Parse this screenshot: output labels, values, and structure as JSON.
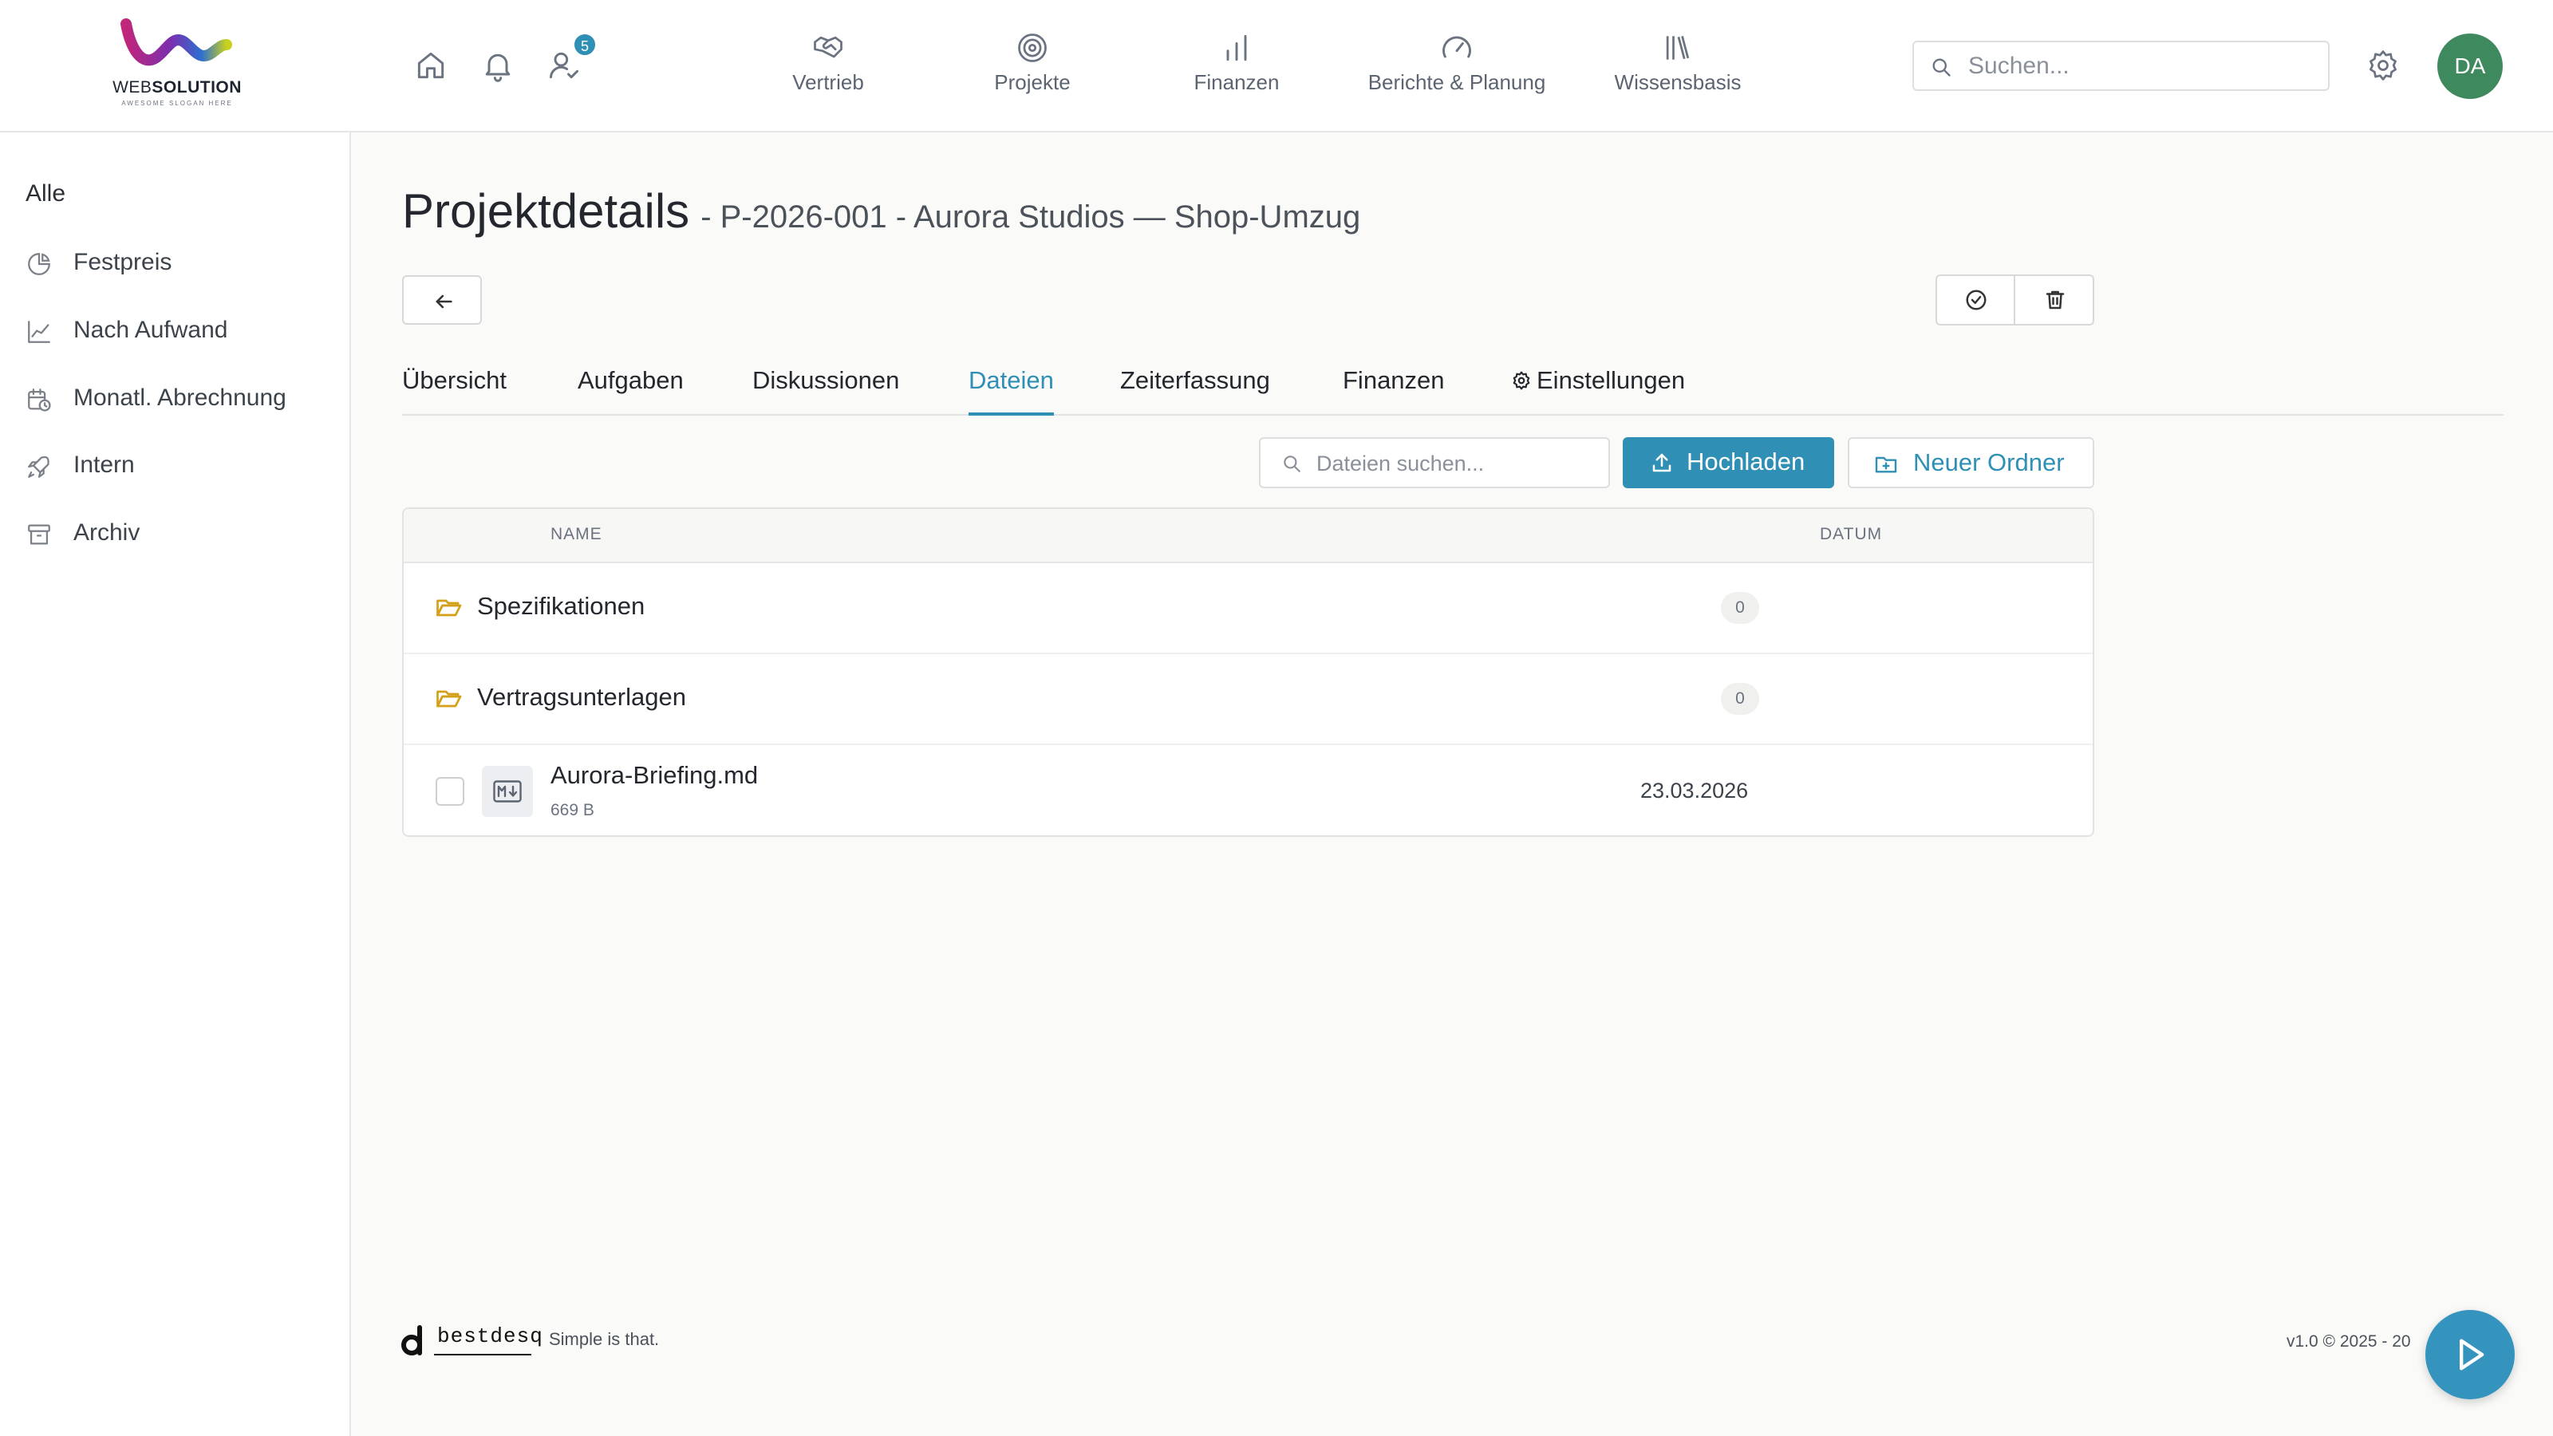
{
  "brand": {
    "name_bold": "WEB",
    "name_rest": "SOLUTION",
    "tagline": "AWESOME SLOGAN HERE"
  },
  "header": {
    "notification_count": "5",
    "nav": [
      {
        "label": "Vertrieb",
        "icon": "handshake-icon"
      },
      {
        "label": "Projekte",
        "icon": "target-icon"
      },
      {
        "label": "Finanzen",
        "icon": "bar-chart-icon"
      },
      {
        "label": "Berichte & Planung",
        "icon": "gauge-icon"
      },
      {
        "label": "Wissensbasis",
        "icon": "library-icon"
      }
    ],
    "search_placeholder": "Suchen...",
    "avatar_initials": "DA",
    "accent_color": "#2f8fb5",
    "avatar_color": "#3e8a5e"
  },
  "sidebar": {
    "all_label": "Alle",
    "items": [
      {
        "label": "Festpreis",
        "icon": "pie-chart-icon"
      },
      {
        "label": "Nach Aufwand",
        "icon": "line-chart-icon"
      },
      {
        "label": "Monatl. Abrechnung",
        "icon": "calendar-clock-icon"
      },
      {
        "label": "Intern",
        "icon": "rocket-icon"
      },
      {
        "label": "Archiv",
        "icon": "archive-icon"
      }
    ]
  },
  "page": {
    "title": "Projektdetails",
    "subtitle": "- P-2026-001 - Aurora Studios — Shop-Umzug"
  },
  "tabs": [
    {
      "label": "Übersicht",
      "active": false
    },
    {
      "label": "Aufgaben",
      "active": false
    },
    {
      "label": "Diskussionen",
      "active": false
    },
    {
      "label": "Dateien",
      "active": true
    },
    {
      "label": "Zeiterfassung",
      "active": false
    },
    {
      "label": "Finanzen",
      "active": false
    },
    {
      "label": "Einstellungen",
      "active": false
    }
  ],
  "files": {
    "search_placeholder": "Dateien suchen...",
    "upload_label": "Hochladen",
    "new_folder_label": "Neuer Ordner",
    "columns": {
      "name": "NAME",
      "date": "DATUM"
    },
    "folders": [
      {
        "name": "Spezifikationen",
        "count": "0"
      },
      {
        "name": "Vertragsunterlagen",
        "count": "0"
      }
    ],
    "items": [
      {
        "name": "Aurora-Briefing.md",
        "size": "669 B",
        "date": "23.03.2026",
        "icon": "markdown-icon"
      }
    ]
  },
  "footer": {
    "brand": "bestdesq",
    "tagline": "Simple is that.",
    "copyright": "v1.0 © 2025 - 20"
  }
}
